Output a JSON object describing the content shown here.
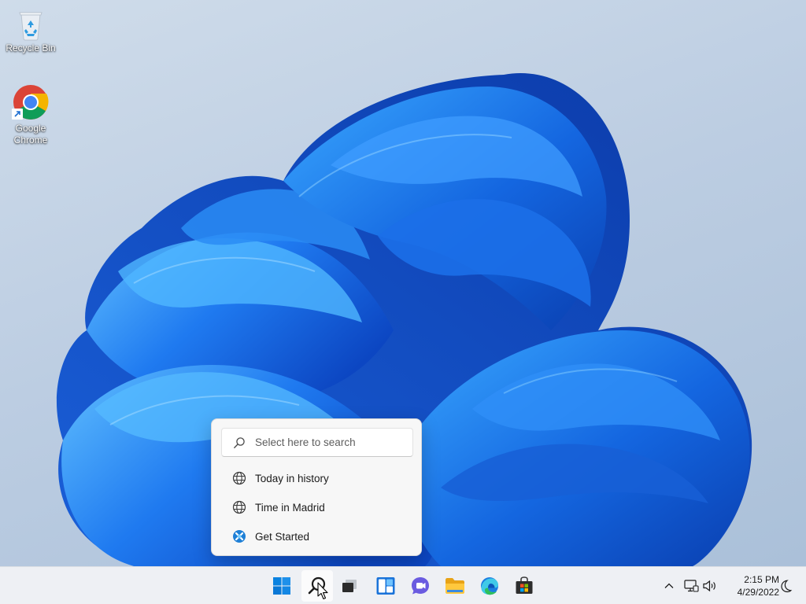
{
  "desktop": {
    "icons": [
      {
        "label": "Recycle Bin",
        "icon": "recycle-bin-icon"
      },
      {
        "label": "Google Chrome",
        "icon": "chrome-icon"
      }
    ]
  },
  "search_flyout": {
    "placeholder": "Select here to search",
    "items": [
      {
        "label": "Today in history",
        "icon": "globe-icon"
      },
      {
        "label": "Time in Madrid",
        "icon": "globe-icon"
      },
      {
        "label": "Get Started",
        "icon": "get-started-icon"
      }
    ]
  },
  "taskbar": {
    "apps": [
      {
        "name": "Start",
        "icon": "windows-logo-icon"
      },
      {
        "name": "Search",
        "icon": "search-icon",
        "active": true
      },
      {
        "name": "Task View",
        "icon": "task-view-icon"
      },
      {
        "name": "Widgets",
        "icon": "widgets-icon"
      },
      {
        "name": "Chat",
        "icon": "chat-icon"
      },
      {
        "name": "File Explorer",
        "icon": "folder-icon"
      },
      {
        "name": "Microsoft Edge",
        "icon": "edge-icon"
      },
      {
        "name": "Microsoft Store",
        "icon": "store-icon"
      }
    ],
    "tray": {
      "icons": [
        "chevron-up-icon",
        "network-icon",
        "volume-icon",
        "focus-assist-icon"
      ],
      "time": "2:15 PM",
      "date": "4/29/2022"
    }
  },
  "colors": {
    "accent": "#0067c0",
    "wallpaper_blue": "#1a6fe6"
  }
}
